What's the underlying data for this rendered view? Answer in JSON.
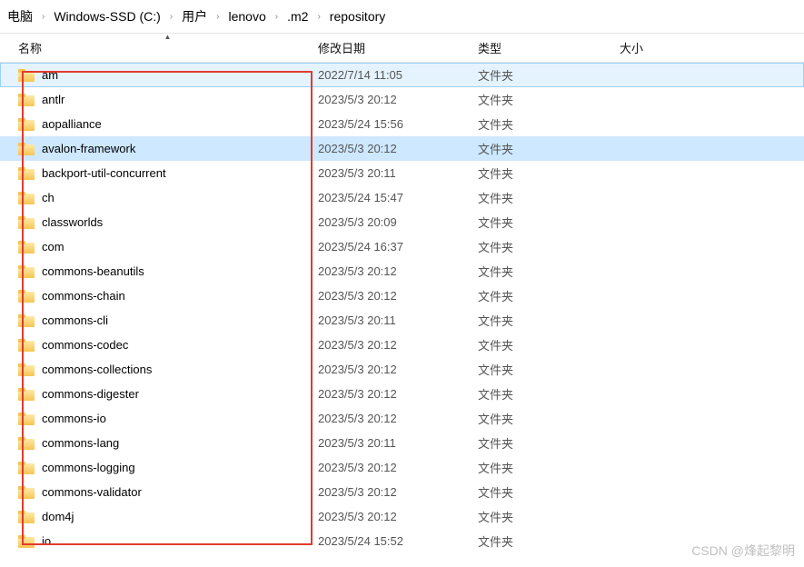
{
  "breadcrumb": {
    "items": [
      "电脑",
      "Windows-SSD (C:)",
      "用户",
      "lenovo",
      ".m2",
      "repository"
    ]
  },
  "columns": {
    "name": "名称",
    "date": "修改日期",
    "type": "类型",
    "size": "大小"
  },
  "type_folder": "文件夹",
  "rows": [
    {
      "name": "am",
      "date": "2022/7/14 11:05",
      "highlighted": true
    },
    {
      "name": "antlr",
      "date": "2023/5/3 20:12"
    },
    {
      "name": "aopalliance",
      "date": "2023/5/24 15:56"
    },
    {
      "name": "avalon-framework",
      "date": "2023/5/3 20:12",
      "selected": true
    },
    {
      "name": "backport-util-concurrent",
      "date": "2023/5/3 20:11"
    },
    {
      "name": "ch",
      "date": "2023/5/24 15:47"
    },
    {
      "name": "classworlds",
      "date": "2023/5/3 20:09"
    },
    {
      "name": "com",
      "date": "2023/5/24 16:37"
    },
    {
      "name": "commons-beanutils",
      "date": "2023/5/3 20:12"
    },
    {
      "name": "commons-chain",
      "date": "2023/5/3 20:12"
    },
    {
      "name": "commons-cli",
      "date": "2023/5/3 20:11"
    },
    {
      "name": "commons-codec",
      "date": "2023/5/3 20:12"
    },
    {
      "name": "commons-collections",
      "date": "2023/5/3 20:12"
    },
    {
      "name": "commons-digester",
      "date": "2023/5/3 20:12"
    },
    {
      "name": "commons-io",
      "date": "2023/5/3 20:12"
    },
    {
      "name": "commons-lang",
      "date": "2023/5/3 20:11"
    },
    {
      "name": "commons-logging",
      "date": "2023/5/3 20:12"
    },
    {
      "name": "commons-validator",
      "date": "2023/5/3 20:12"
    },
    {
      "name": "dom4j",
      "date": "2023/5/3 20:12"
    },
    {
      "name": "io",
      "date": "2023/5/24 15:52"
    }
  ],
  "watermark": "CSDN @烽起黎明"
}
